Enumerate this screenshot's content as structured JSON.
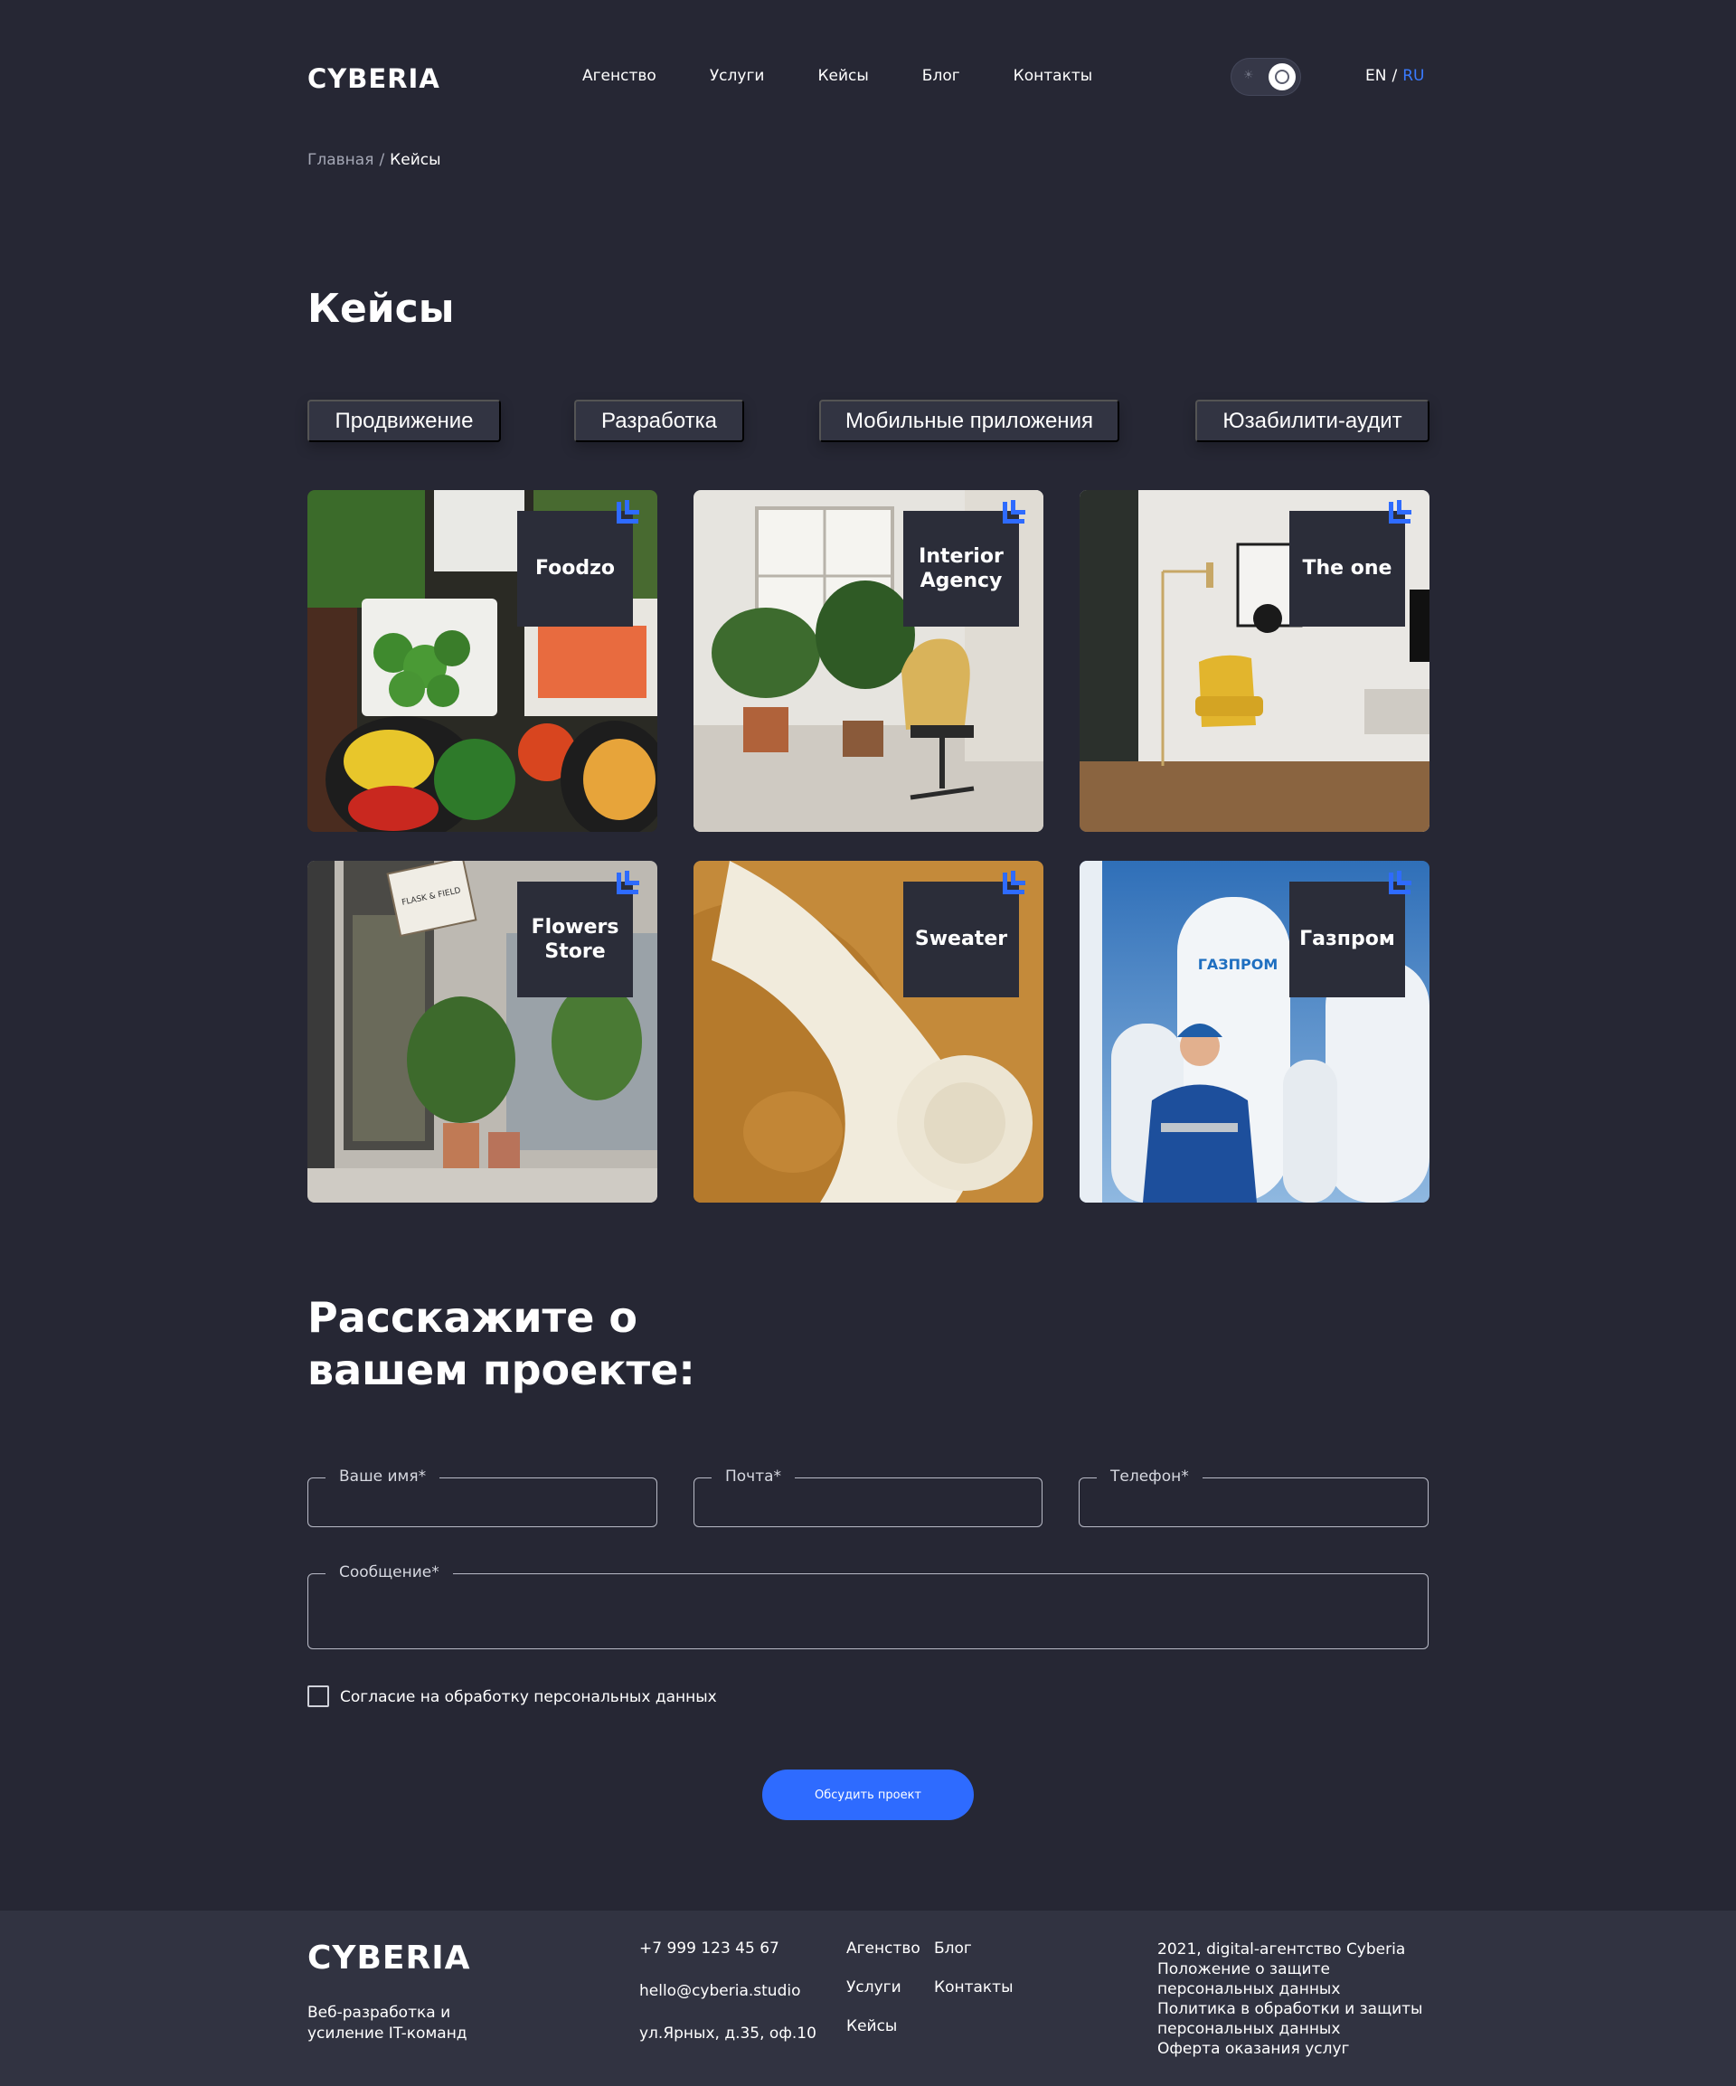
{
  "header": {
    "logo": "CYBERIA",
    "nav": [
      "Агенство",
      "Услуги",
      "Кейсы",
      "Блог",
      "Контакты"
    ],
    "theme_toggle": {
      "sun_icon": "☀"
    },
    "lang": {
      "en": "EN",
      "sep": "/",
      "ru": "RU"
    }
  },
  "breadcrumb": {
    "home": "Главная",
    "sep": "/",
    "current": "Кейсы"
  },
  "page_title": "Кейсы",
  "filters": [
    "Продвижение",
    "Разработка",
    "Мобильные приложения",
    "Юзабилити-аудит"
  ],
  "cases": [
    {
      "label": "Foodzo"
    },
    {
      "label": "Interior Agency"
    },
    {
      "label": "The one"
    },
    {
      "label": "Flowers Store"
    },
    {
      "label": "Sweater"
    },
    {
      "label": "Газпром"
    }
  ],
  "case_images": {
    "flowers_sign": "FLASK & FIELD",
    "gazprom_logo": "ГАЗПРОМ"
  },
  "form": {
    "title_line1": "Расскажите о",
    "title_line2": "вашем проекте:",
    "name_label": "Ваше имя*",
    "email_label": "Почта*",
    "phone_label": "Телефон*",
    "message_label": "Сообщение*",
    "consent": "Согласие на обработку персональных данных",
    "submit": "Обсудить проект"
  },
  "footer": {
    "logo": "CYBERIA",
    "tagline": "Веб-разработка и усиление IT-команд",
    "phone": "+7 999 123 45 67",
    "email": "hello@cyberia.studio",
    "address": "ул.Ярных, д.35, оф.10",
    "nav_col1": [
      "Агенство",
      "Услуги",
      "Кейсы"
    ],
    "nav_col2": [
      "Блог",
      "Контакты"
    ],
    "legal": [
      "2021, digital-агентство Cyberia",
      "Положение о защите персональных данных",
      "Политика в обработки и защиты персональных данных",
      "Оферта оказания услуг"
    ]
  },
  "colors": {
    "background": "#262734",
    "accent": "#2e6bff",
    "footer": "#313341"
  }
}
